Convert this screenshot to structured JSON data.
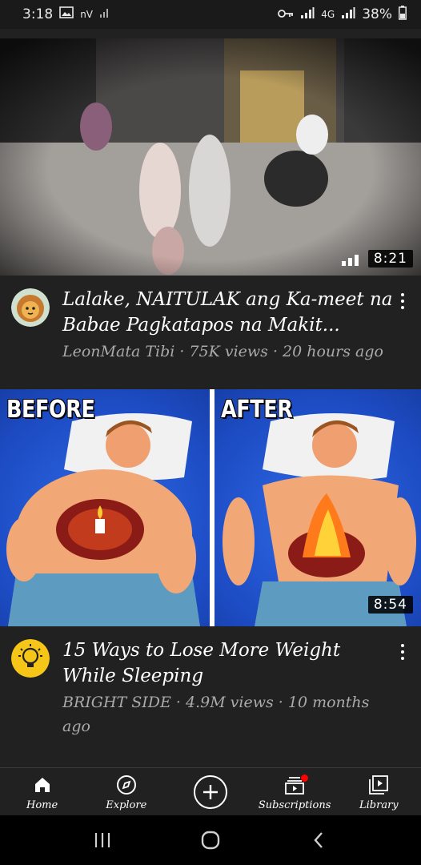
{
  "status_bar": {
    "time": "3:18",
    "left_extra": "nV",
    "battery": "38%",
    "network": "4G"
  },
  "videos": [
    {
      "title": "Lalake, NAITULAK ang Ka-meet na Babae Pagkatapos na Makit...",
      "meta": "LeonMata Tibi · 75K views · 20 hours ago",
      "duration": "8:21",
      "avatar_icon": "lion-avatar-icon"
    },
    {
      "title": "15 Ways to Lose More Weight While Sleeping",
      "meta": "BRIGHT SIDE · 4.9M views · 10 months ago",
      "duration": "8:54",
      "before_label": "BEFORE",
      "after_label": "AFTER",
      "avatar_icon": "lightbulb-avatar-icon"
    }
  ],
  "bottom_nav": [
    {
      "label": "Home",
      "icon": "home-icon",
      "active": true
    },
    {
      "label": "Explore",
      "icon": "compass-icon"
    },
    {
      "label": "",
      "icon": "add-icon"
    },
    {
      "label": "Subscriptions",
      "icon": "subscriptions-icon"
    },
    {
      "label": "Library",
      "icon": "library-icon"
    }
  ],
  "colors": {
    "background": "#212121",
    "meta_text": "#aaaaaa",
    "notification": "#ff0000",
    "thumb_blue": "#1d4cc4"
  }
}
